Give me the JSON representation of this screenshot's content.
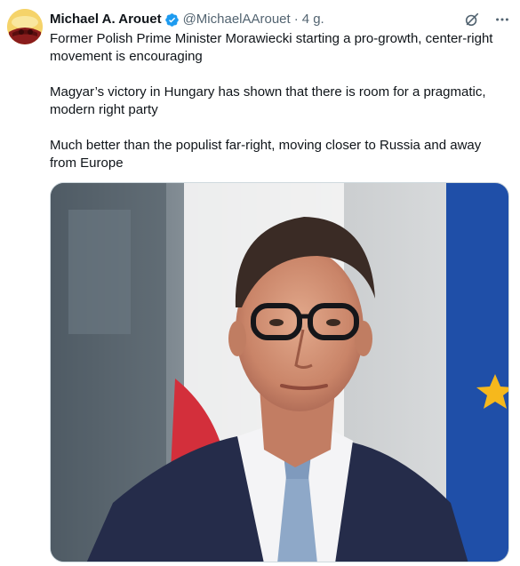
{
  "tweet": {
    "author_name": "Michael A. Arouet",
    "author_handle": "@MichaelAArouet",
    "separator": "·",
    "time": "4 g.",
    "paragraphs": [
      "Former Polish Prime Minister Morawiecki starting a pro-growth, center-right movement is encouraging",
      "Magyar’s victory in Hungary has shown that there is room for a pragmatic, modern right party",
      "Much better than the populist far-right, moving closer to Russia and away from Europe"
    ]
  },
  "icons": {
    "verified": "verified-badge-icon",
    "grok": "grok-icon",
    "more": "more-icon"
  },
  "colors": {
    "verified_blue": "#1d9bf0",
    "text": "#0f1419",
    "secondary_text": "#536471"
  }
}
